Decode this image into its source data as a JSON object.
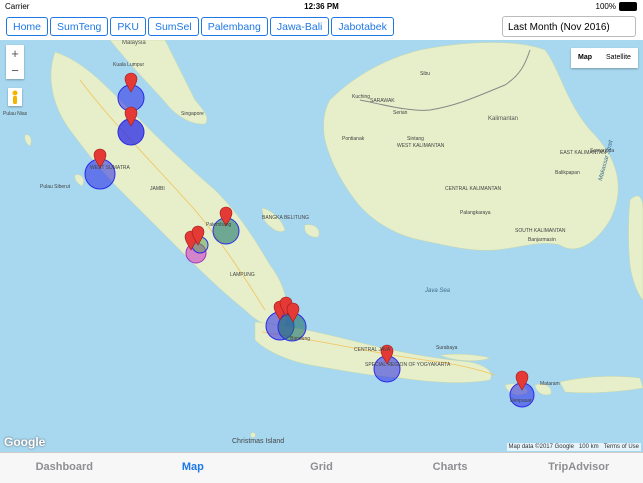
{
  "status": {
    "carrier": "Carrier",
    "time": "12:36 PM",
    "battery": "100%"
  },
  "region_tabs": [
    "Home",
    "SumTeng",
    "PKU",
    "SumSel",
    "Palembang",
    "Jawa-Bali",
    "Jabotabek"
  ],
  "period_select": "Last Month (Nov 2016)",
  "map": {
    "type_options": [
      "Map",
      "Satellite"
    ],
    "zoom_in": "+",
    "zoom_out": "−",
    "logo": "Google",
    "attribution": [
      "Map data ©2017 Google",
      "100 km",
      "Terms of Use"
    ],
    "labels": {
      "malaysia": "Malaysia",
      "kuala_lumpur": "Kuala Lumpur",
      "singapore": "Singapore",
      "pulau_nias": "Pulau Nias",
      "west_sumatra": "WEST SUMATRA",
      "pulau_siberut": "Pulau Siberut",
      "jambi": "JAMBI",
      "bangka": "BANGKA BELITUNG",
      "palembang": "Palembang",
      "lampung": "LAMPUNG",
      "bandung": "Bandung",
      "central_java": "CENTRAL JAVA",
      "yogyakarta": "SPECIAL REGION OF YOGYAKARTA",
      "surabaya": "Surabaya",
      "java_sea": "Java Sea",
      "mataram": "Mataram",
      "denpasar": "Denpasar",
      "pontianak": "Pontianak",
      "west_kalimantan": "WEST KALIMANTAN",
      "kalimantan": "Kalimantan",
      "central_kalimantan": "CENTRAL KALIMANTAN",
      "palangkaraya": "Palangkaraya",
      "south_kalimantan": "SOUTH KALIMANTAN",
      "east_kalimantan": "EAST KALIMANTAN",
      "balikpapan": "Balikpapan",
      "samarinda": "Samarinda",
      "banjarmasin": "Banjarmasin",
      "makassar": "Makassar Strait",
      "kuching": "Kuching",
      "sarawak": "SARAWAK",
      "serian": "Serian",
      "sibu": "Sibu",
      "sintang": "Sintang",
      "christmas": "Christmas Island"
    }
  },
  "tabbar": [
    "Dashboard",
    "Map",
    "Grid",
    "Charts",
    "TripAdvisor"
  ],
  "colors": {
    "accent": "#1e78e6",
    "water": "#a8d8f0",
    "land": "#e6efc9",
    "pin": "#e53935"
  }
}
